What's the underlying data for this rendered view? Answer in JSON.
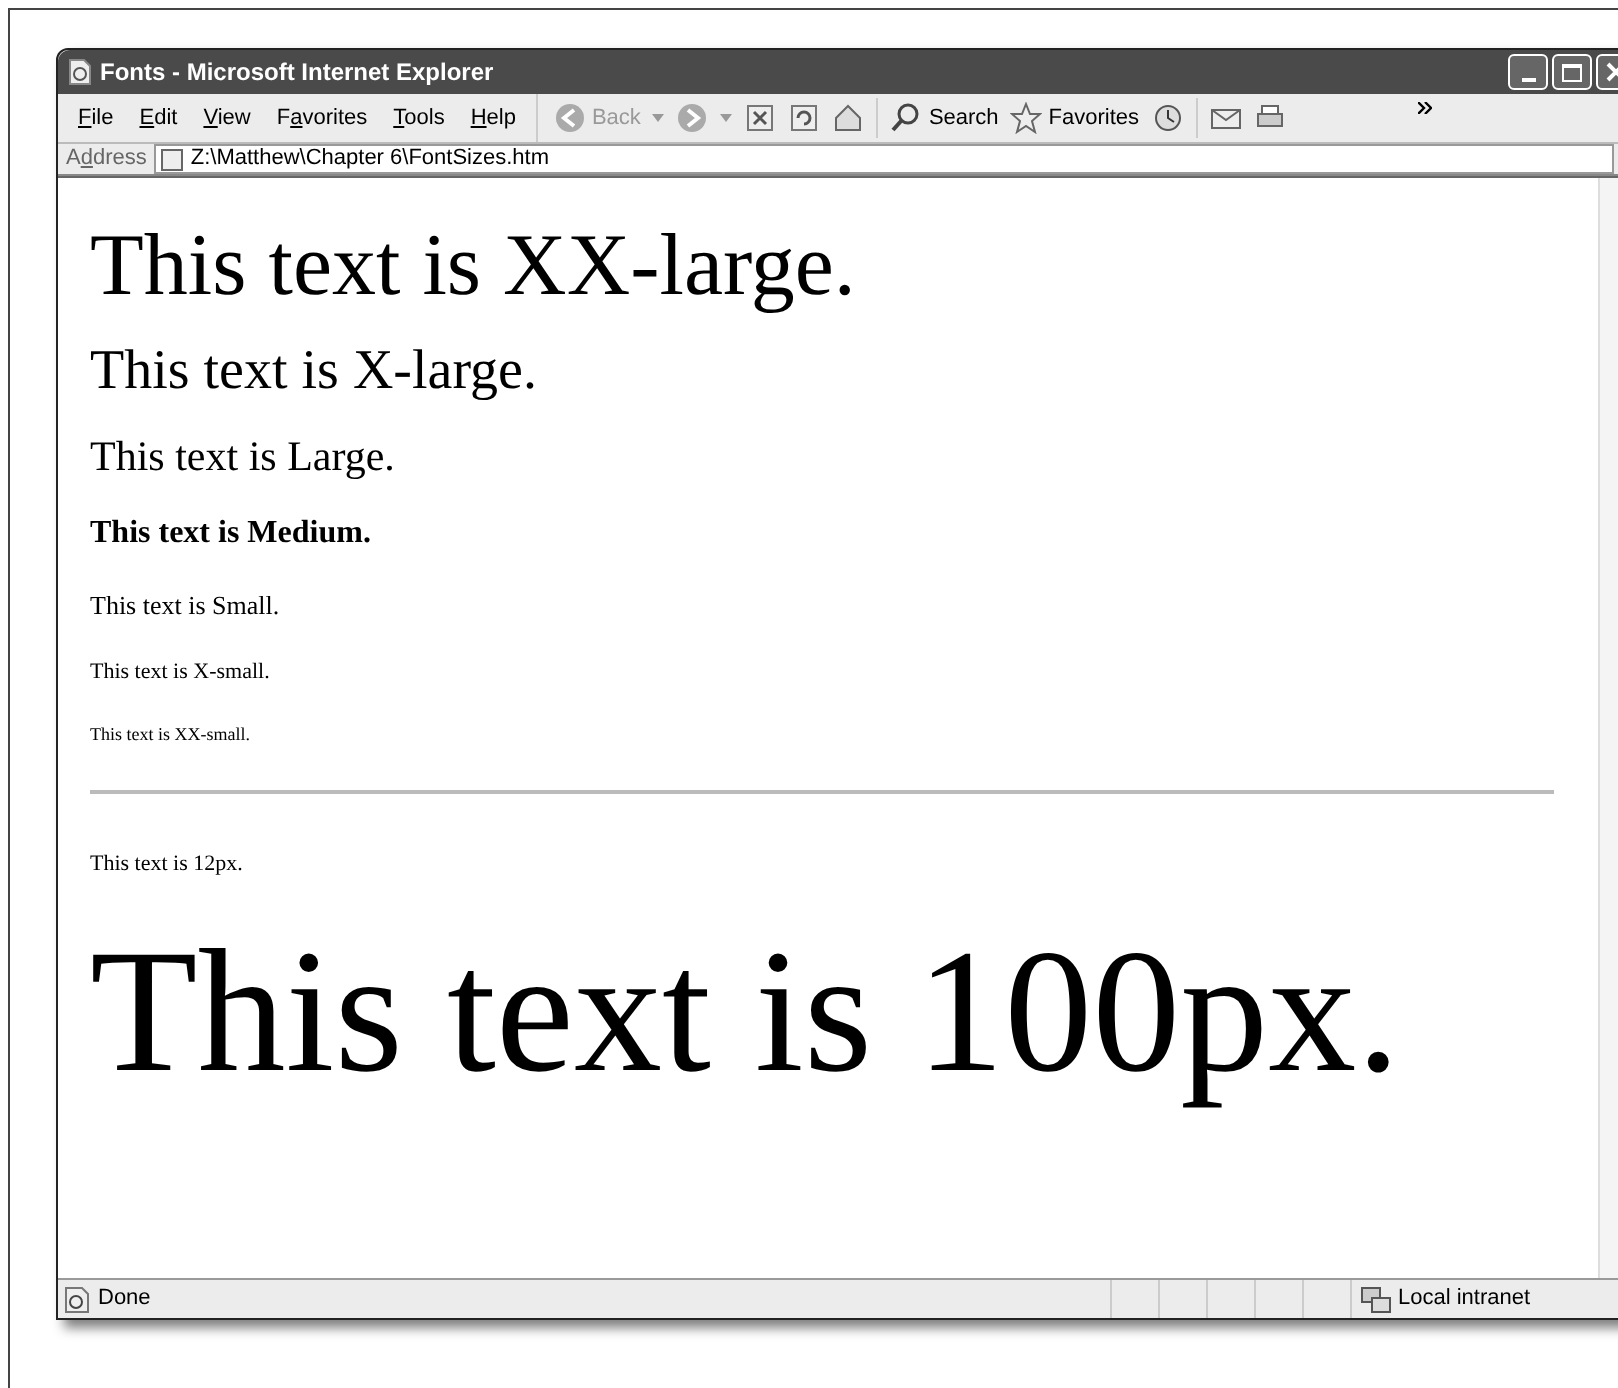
{
  "window": {
    "title": "Fonts - Microsoft Internet Explorer"
  },
  "menu": [
    {
      "key": "F",
      "after": "ile"
    },
    {
      "key": "E",
      "after": "dit"
    },
    {
      "key": "V",
      "after": "iew"
    },
    {
      "before": "F",
      "key": "a",
      "after": "vorites"
    },
    {
      "key": "T",
      "after": "ools"
    },
    {
      "key": "H",
      "after": "elp"
    }
  ],
  "toolbar": [
    {
      "kind": "back",
      "label": "Back",
      "disabled": true
    },
    {
      "kind": "search",
      "label": "Search",
      "disabled": false
    },
    {
      "kind": "favorites",
      "label": "Favorites",
      "disabled": false
    }
  ],
  "address": {
    "label": {
      "before": "A",
      "key": "d",
      "after": "dress"
    },
    "value": "Z:\\Matthew\\Chapter 6\\FontSizes.htm"
  },
  "content": {
    "named_sizes": [
      {
        "kind": "huge",
        "text": "This text is XX-large."
      },
      {
        "kind": "bigger",
        "text": "This text is X-large."
      },
      {
        "kind": "big",
        "text": "This text is Large."
      },
      {
        "kind": "normal",
        "text": "This text is Medium."
      },
      {
        "kind": "little",
        "text": "This text is Small."
      },
      {
        "kind": "smaller",
        "text": "This text is X-small."
      },
      {
        "kind": "tiny",
        "text": "This text is XX-small."
      }
    ],
    "pixel_sizes": [
      {
        "kind": "fixed_small",
        "text": "This text is 12px."
      },
      {
        "kind": "fixed_giant",
        "text": "This text is 100px."
      }
    ]
  },
  "status_bar": {
    "text": "Done",
    "zone": "Local intranet"
  }
}
